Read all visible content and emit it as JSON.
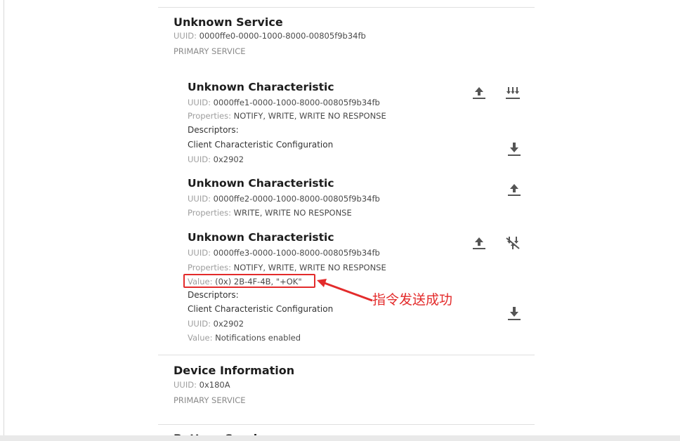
{
  "services": [
    {
      "name": "Unknown Service",
      "uuid_label": "UUID:",
      "uuid": "0000ffe0-0000-1000-8000-00805f9b34fb",
      "type": "PRIMARY SERVICE",
      "characteristics": [
        {
          "name": "Unknown Characteristic",
          "uuid_label": "UUID:",
          "uuid": "0000ffe1-0000-1000-8000-00805f9b34fb",
          "properties_label": "Properties:",
          "properties": "NOTIFY, WRITE, WRITE NO RESPONSE",
          "descriptors_label": "Descriptors:",
          "descriptor": {
            "name": "Client Characteristic Configuration",
            "uuid_label": "UUID:",
            "uuid": "0x2902"
          }
        },
        {
          "name": "Unknown Characteristic",
          "uuid_label": "UUID:",
          "uuid": "0000ffe2-0000-1000-8000-00805f9b34fb",
          "properties_label": "Properties:",
          "properties": "WRITE, WRITE NO RESPONSE"
        },
        {
          "name": "Unknown Characteristic",
          "uuid_label": "UUID:",
          "uuid": "0000ffe3-0000-1000-8000-00805f9b34fb",
          "properties_label": "Properties:",
          "properties": "NOTIFY, WRITE, WRITE NO RESPONSE",
          "value_label": "Value:",
          "value": "(0x) 2B-4F-4B, \"+OK\"",
          "descriptors_label": "Descriptors:",
          "descriptor": {
            "name": "Client Characteristic Configuration",
            "uuid_label": "UUID:",
            "uuid": "0x2902",
            "value_label": "Value:",
            "value": "Notifications enabled"
          }
        }
      ]
    },
    {
      "name": "Device Information",
      "uuid_label": "UUID:",
      "uuid": "0x180A",
      "type": "PRIMARY SERVICE"
    },
    {
      "name": "Battery Service"
    }
  ],
  "annotation": {
    "text": "指令发送成功",
    "color": "#e32b2b"
  },
  "icons": {
    "write": "upload-arrow-icon",
    "notify_enable": "multi-down-arrows-icon",
    "notify_disable": "notifications-disabled-icon",
    "descriptor_write": "download-arrow-icon"
  }
}
